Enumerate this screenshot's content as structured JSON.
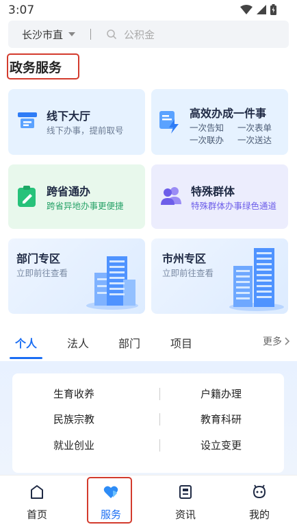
{
  "status": {
    "time": "3:07"
  },
  "search": {
    "city": "长沙市直",
    "divider": "|",
    "placeholder": "公积金"
  },
  "section_title": "政务服务",
  "cards": [
    {
      "title": "线下大厅",
      "subtitle": "线下办事，提前取号",
      "icon": "counter-icon"
    },
    {
      "title": "高效办成一件事",
      "lines": [
        "一次告知",
        "一次表单",
        "一次联办",
        "一次送达"
      ],
      "icon": "document-bolt-icon"
    },
    {
      "title": "跨省通办",
      "subtitle": "跨省异地办事更便捷",
      "icon": "clipboard-edit-icon"
    },
    {
      "title": "特殊群体",
      "subtitle": "特殊群体办事绿色通道",
      "icon": "people-icon"
    },
    {
      "title": "部门专区",
      "subtitle": "立即前往查看",
      "icon": "building-icon"
    },
    {
      "title": "市州专区",
      "subtitle": "立即前往查看",
      "icon": "skyscraper-icon"
    }
  ],
  "tabs": [
    {
      "label": "个人",
      "active": true
    },
    {
      "label": "法人"
    },
    {
      "label": "部门"
    },
    {
      "label": "项目"
    }
  ],
  "more_label": "更多",
  "categories": [
    [
      "生育收养",
      "户籍办理"
    ],
    [
      "民族宗教",
      "教育科研"
    ],
    [
      "就业创业",
      "设立变更"
    ]
  ],
  "nav": [
    {
      "label": "首页",
      "icon": "home-icon"
    },
    {
      "label": "服务",
      "icon": "heart-icon",
      "active": true
    },
    {
      "label": "资讯",
      "icon": "news-icon"
    },
    {
      "label": "我的",
      "icon": "profile-icon"
    }
  ],
  "colors": {
    "accent": "#1b6ef3",
    "highlight": "#d33a2c"
  }
}
